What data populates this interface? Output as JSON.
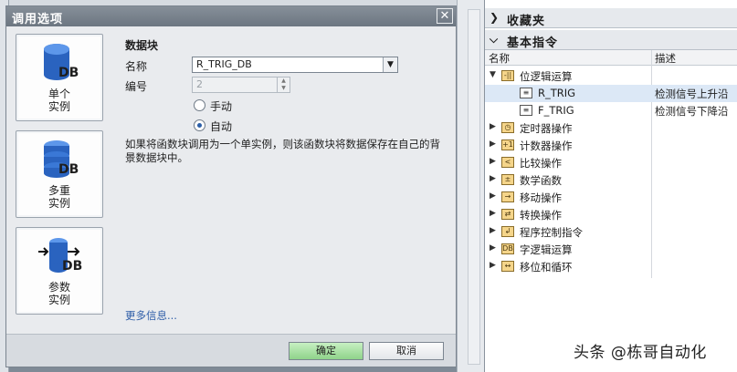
{
  "dialog": {
    "title": "调用选项",
    "close": "✕",
    "instances": [
      {
        "line1": "单个",
        "line2": "实例"
      },
      {
        "line1": "多重",
        "line2": "实例"
      },
      {
        "line1": "参数",
        "line2": "实例"
      }
    ],
    "db_badge": "DB",
    "section_title": "数据块",
    "name_label": "名称",
    "name_value": "R_TRIG_DB",
    "number_label": "编号",
    "number_value": "2",
    "radio_manual": "手动",
    "radio_auto": "自动",
    "description": "如果将函数块调用为一个单实例，则该函数块将数据保存在自己的背景数据块中。",
    "more_info": "更多信息...",
    "ok": "确定",
    "cancel": "取消"
  },
  "panel": {
    "favorites": "收藏夹",
    "basic": "基本指令",
    "col_name": "名称",
    "col_desc": "描述",
    "bit_logic": "位逻辑运算",
    "rtrig": "R_TRIG",
    "rtrig_desc": "检测信号上升沿",
    "ftrig": "F_TRIG",
    "ftrig_desc": "检测信号下降沿",
    "items": [
      "定时器操作",
      "计数器操作",
      "比较操作",
      "数学函数",
      "移动操作",
      "转换操作",
      "程序控制指令",
      "字逻辑运算",
      "移位和循环"
    ]
  },
  "watermark": "头条 @栋哥自动化"
}
